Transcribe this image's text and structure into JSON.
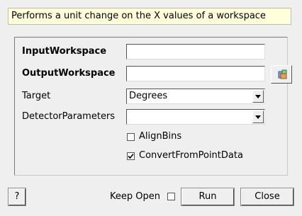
{
  "description": "Performs a unit change on the X values of a workspace",
  "fields": {
    "input_workspace": {
      "label": "InputWorkspace",
      "value": ""
    },
    "output_workspace": {
      "label": "OutputWorkspace",
      "value": ""
    },
    "target": {
      "label": "Target",
      "value": "Degrees"
    },
    "detector_parameters": {
      "label": "DetectorParameters",
      "value": ""
    }
  },
  "checkboxes": {
    "align_bins": {
      "label": "AlignBins",
      "checked": false
    },
    "convert_from_point_data": {
      "label": "ConvertFromPointData",
      "checked": true
    }
  },
  "footer": {
    "help_label": "?",
    "keep_open_label": "Keep Open",
    "keep_open_checked": false,
    "run_label": "Run",
    "close_label": "Close"
  },
  "icons": {
    "browse": "workspace-browse-icon"
  }
}
